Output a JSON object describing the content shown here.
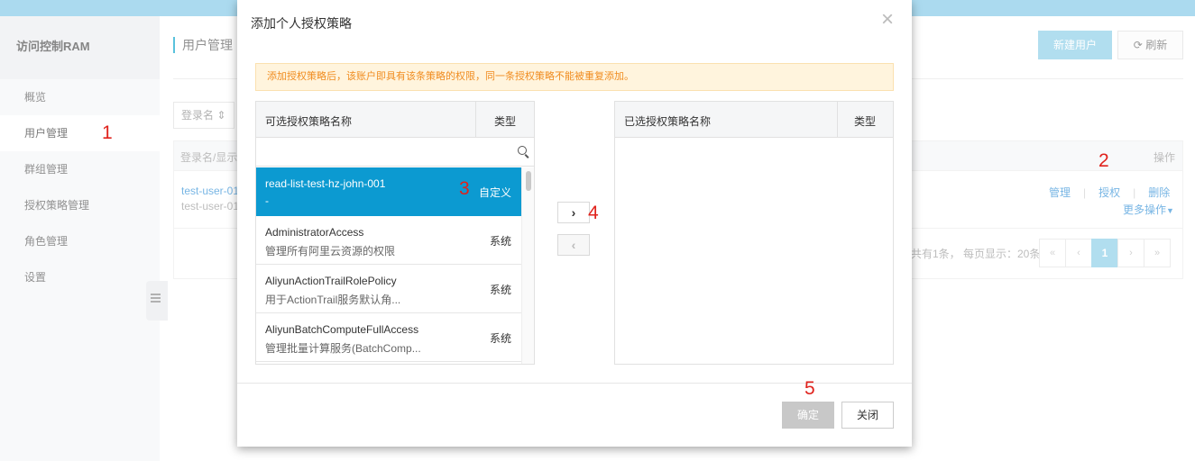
{
  "sidebar": {
    "brand": "访问控制RAM",
    "items": [
      {
        "label": "概览"
      },
      {
        "label": "用户管理"
      },
      {
        "label": "群组管理"
      },
      {
        "label": "授权策略管理"
      },
      {
        "label": "角色管理"
      },
      {
        "label": "设置"
      }
    ]
  },
  "main": {
    "title": "用户管理",
    "new_user_button": "新建用户",
    "refresh_button": "刷新",
    "filter_select": "登录名",
    "table": {
      "col_login": "登录名/显示",
      "col_ops": "操作",
      "row": {
        "login": "test-user-01",
        "display": "test-user-01"
      },
      "actions": {
        "manage": "管理",
        "authorize": "授权",
        "delete": "删除",
        "more": "更多操作"
      }
    },
    "pager": {
      "info": "共有1条， 每页显示：20条",
      "first": "«",
      "prev": "‹",
      "current": "1",
      "next": "›",
      "last": "»"
    }
  },
  "modal": {
    "title": "添加个人授权策略",
    "close_icon": "×",
    "notice": "添加授权策略后，该账户即具有该条策略的权限，同一条授权策略不能被重复添加。",
    "left_panel": {
      "name_header": "可选授权策略名称",
      "type_header": "类型",
      "search_value": "",
      "items": [
        {
          "name": "read-list-test-hz-john-001",
          "desc": "-",
          "type": "自定义"
        },
        {
          "name": "AdministratorAccess",
          "desc": "管理所有阿里云资源的权限",
          "type": "系统"
        },
        {
          "name": "AliyunActionTrailRolePolicy",
          "desc": "用于ActionTrail服务默认角...",
          "type": "系统"
        },
        {
          "name": "AliyunBatchComputeFullAccess",
          "desc": "管理批量计算服务(BatchComp...",
          "type": "系统"
        }
      ]
    },
    "right_panel": {
      "name_header": "已选授权策略名称",
      "type_header": "类型"
    },
    "move_right": "›",
    "move_left": "‹",
    "ok_button": "确定",
    "close_button": "关闭"
  },
  "annotations": {
    "a1": "1",
    "a2": "2",
    "a3": "3",
    "a4": "4",
    "a5": "5"
  },
  "colors": {
    "accent": "#0c9ad1",
    "topbar": "#7ec6e6",
    "annotation": "#e0221c",
    "notice_text": "#f08c1f"
  }
}
